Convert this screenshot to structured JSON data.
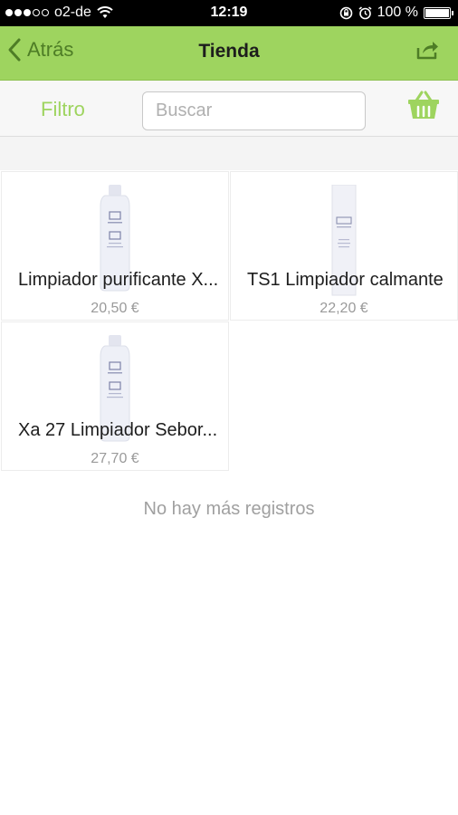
{
  "status_bar": {
    "carrier": "o2-de",
    "time": "12:19",
    "battery": "100 %",
    "battery_level": 1.0,
    "signal_bars_filled": 3,
    "signal_bars_total": 5
  },
  "nav": {
    "back_label": "Atrás",
    "title": "Tienda"
  },
  "search_row": {
    "filter_label": "Filtro",
    "search_placeholder": "Buscar",
    "search_value": ""
  },
  "products": [
    {
      "name": "Limpiador purificante X...",
      "price": "20,50 €",
      "image": "bottle"
    },
    {
      "name": "TS1 Limpiador calmante",
      "price": "22,20 €",
      "image": "tube"
    },
    {
      "name": "Xa 27 Limpiador Sebor...",
      "price": "27,70 €",
      "image": "bottle"
    }
  ],
  "end_message": "No hay más registros",
  "colors": {
    "accent": "#9ed45f",
    "back_text": "#4e7d26",
    "muted_text": "#a0a0a0"
  },
  "icons": {
    "back": "chevron-left-icon",
    "share": "share-icon",
    "basket": "basket-icon",
    "wifi": "wifi-icon",
    "lock": "rotation-lock-icon",
    "alarm": "alarm-icon",
    "battery": "battery-icon"
  }
}
